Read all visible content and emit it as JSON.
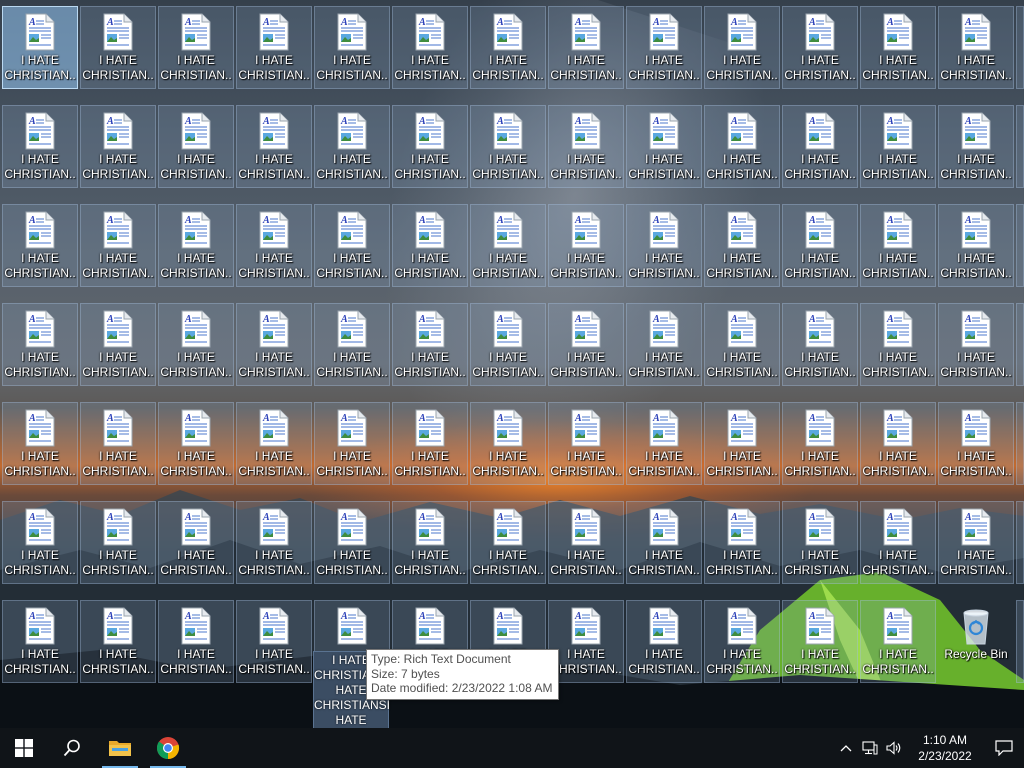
{
  "desktop": {
    "file_label": "I HATE CHRISTIAN...",
    "file_label_line1": "I HATE",
    "file_label_line2": "CHRISTIAN...",
    "expanded_label": "I HATE CHRISTIANSI HATE CHRISTIANSI HATE",
    "expanded_label_lines": [
      "I HATE",
      "CHRISTIANSI",
      "HATE",
      "CHRISTIANSI",
      "HATE"
    ],
    "recycle_bin_label": "Recycle Bin",
    "columns": 13,
    "rows": 7,
    "selected_index": 0,
    "hovered_row": 6,
    "hovered_col": 4,
    "icon_name": "rtf-document-icon"
  },
  "tooltip": {
    "type_line": "Type: Rich Text Document",
    "size_line": "Size: 7 bytes",
    "date_line": "Date modified: 2/23/2022 1:08 AM"
  },
  "taskbar": {
    "start_icon": "windows-start-icon",
    "search_icon": "search-icon",
    "pinned": [
      "file-explorer-icon",
      "chrome-icon"
    ],
    "tray": {
      "chevron_icon": "chevron-up-icon",
      "network_icon": "network-icon",
      "volume_icon": "volume-icon",
      "time": "1:10 AM",
      "date": "2/23/2022",
      "notification_icon": "notification-icon"
    }
  },
  "colors": {
    "taskbar_bg": "#101418",
    "selection": "#96c8f5",
    "accent_blue": "#76b9ed",
    "folder_yellow": "#f3c34a"
  }
}
